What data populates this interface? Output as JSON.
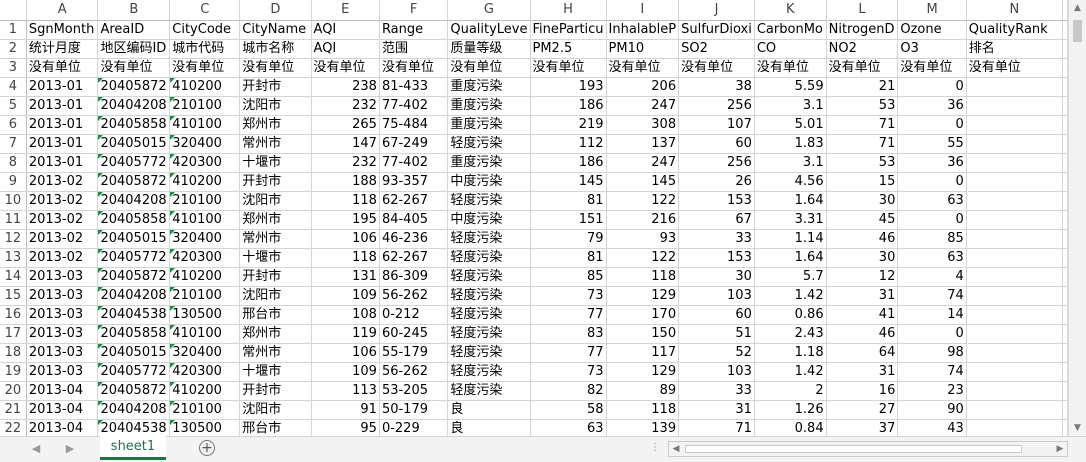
{
  "columns": [
    "A",
    "B",
    "C",
    "D",
    "E",
    "F",
    "G",
    "H",
    "I",
    "J",
    "K",
    "L",
    "M",
    "N"
  ],
  "rows": [
    {
      "n": "1",
      "cells": [
        "SgnMonth",
        "AreaID",
        "CityCode",
        "CityName",
        "AQI",
        "Range",
        "QualityLeve",
        "FineParticu",
        "InhalableP",
        "SulfurDioxi",
        "CarbonMo",
        "NitrogenD",
        "Ozone",
        "QualityRank"
      ]
    },
    {
      "n": "2",
      "cells": [
        "统计月度",
        "地区编码ID",
        "城市代码",
        "城市名称",
        "AQI",
        "范围",
        "质量等级",
        "PM2.5",
        "PM10",
        "SO2",
        "CO",
        "NO2",
        "O3",
        "排名"
      ]
    },
    {
      "n": "3",
      "cells": [
        "没有单位",
        "没有单位",
        "没有单位",
        "没有单位",
        "没有单位",
        "没有单位",
        "没有单位",
        "没有单位",
        "没有单位",
        "没有单位",
        "没有单位",
        "没有单位",
        "没有单位",
        "没有单位"
      ]
    },
    {
      "n": "4",
      "cells": [
        "2013-01",
        "20405872",
        "410200",
        "开封市",
        "238",
        "81-433",
        "重度污染",
        "193",
        "206",
        "38",
        "5.59",
        "21",
        "0",
        ""
      ]
    },
    {
      "n": "5",
      "cells": [
        "2013-01",
        "20404208",
        "210100",
        "沈阳市",
        "232",
        "77-402",
        "重度污染",
        "186",
        "247",
        "256",
        "3.1",
        "53",
        "36",
        ""
      ]
    },
    {
      "n": "6",
      "cells": [
        "2013-01",
        "20405858",
        "410100",
        "郑州市",
        "265",
        "75-484",
        "重度污染",
        "219",
        "308",
        "107",
        "5.01",
        "71",
        "0",
        ""
      ]
    },
    {
      "n": "7",
      "cells": [
        "2013-01",
        "20405015",
        "320400",
        "常州市",
        "147",
        "67-249",
        "轻度污染",
        "112",
        "137",
        "60",
        "1.83",
        "71",
        "55",
        ""
      ]
    },
    {
      "n": "8",
      "cells": [
        "2013-01",
        "20405772",
        "420300",
        "十堰市",
        "232",
        "77-402",
        "重度污染",
        "186",
        "247",
        "256",
        "3.1",
        "53",
        "36",
        ""
      ]
    },
    {
      "n": "9",
      "cells": [
        "2013-02",
        "20405872",
        "410200",
        "开封市",
        "188",
        "93-357",
        "中度污染",
        "145",
        "145",
        "26",
        "4.56",
        "15",
        "0",
        ""
      ]
    },
    {
      "n": "10",
      "cells": [
        "2013-02",
        "20404208",
        "210100",
        "沈阳市",
        "118",
        "62-267",
        "轻度污染",
        "81",
        "122",
        "153",
        "1.64",
        "30",
        "63",
        ""
      ]
    },
    {
      "n": "11",
      "cells": [
        "2013-02",
        "20405858",
        "410100",
        "郑州市",
        "195",
        "84-405",
        "中度污染",
        "151",
        "216",
        "67",
        "3.31",
        "45",
        "0",
        ""
      ]
    },
    {
      "n": "12",
      "cells": [
        "2013-02",
        "20405015",
        "320400",
        "常州市",
        "106",
        "46-236",
        "轻度污染",
        "79",
        "93",
        "33",
        "1.14",
        "46",
        "85",
        ""
      ]
    },
    {
      "n": "13",
      "cells": [
        "2013-02",
        "20405772",
        "420300",
        "十堰市",
        "118",
        "62-267",
        "轻度污染",
        "81",
        "122",
        "153",
        "1.64",
        "30",
        "63",
        ""
      ]
    },
    {
      "n": "14",
      "cells": [
        "2013-03",
        "20405872",
        "410200",
        "开封市",
        "131",
        "86-309",
        "轻度污染",
        "85",
        "118",
        "30",
        "5.7",
        "12",
        "4",
        ""
      ]
    },
    {
      "n": "15",
      "cells": [
        "2013-03",
        "20404208",
        "210100",
        "沈阳市",
        "109",
        "56-262",
        "轻度污染",
        "73",
        "129",
        "103",
        "1.42",
        "31",
        "74",
        ""
      ]
    },
    {
      "n": "16",
      "cells": [
        "2013-03",
        "20404538",
        "130500",
        "邢台市",
        "108",
        "0-212",
        "轻度污染",
        "77",
        "170",
        "60",
        "0.86",
        "41",
        "14",
        ""
      ]
    },
    {
      "n": "17",
      "cells": [
        "2013-03",
        "20405858",
        "410100",
        "郑州市",
        "119",
        "60-245",
        "轻度污染",
        "83",
        "150",
        "51",
        "2.43",
        "46",
        "0",
        ""
      ]
    },
    {
      "n": "18",
      "cells": [
        "2013-03",
        "20405015",
        "320400",
        "常州市",
        "106",
        "55-179",
        "轻度污染",
        "77",
        "117",
        "52",
        "1.18",
        "64",
        "98",
        ""
      ]
    },
    {
      "n": "19",
      "cells": [
        "2013-03",
        "20405772",
        "420300",
        "十堰市",
        "109",
        "56-262",
        "轻度污染",
        "73",
        "129",
        "103",
        "1.42",
        "31",
        "74",
        ""
      ]
    },
    {
      "n": "20",
      "cells": [
        "2013-04",
        "20405872",
        "410200",
        "开封市",
        "113",
        "53-205",
        "轻度污染",
        "82",
        "89",
        "33",
        "2",
        "16",
        "23",
        ""
      ]
    },
    {
      "n": "21",
      "cells": [
        "2013-04",
        "20404208",
        "210100",
        "沈阳市",
        "91",
        "50-179",
        "良",
        "58",
        "118",
        "31",
        "1.26",
        "27",
        "90",
        ""
      ]
    },
    {
      "n": "22",
      "cells": [
        "2013-04",
        "20404538",
        "130500",
        "邢台市",
        "95",
        "0-229",
        "良",
        "63",
        "139",
        "71",
        "0.84",
        "37",
        "43",
        ""
      ]
    }
  ],
  "sheet_tab": "sheet1",
  "icons": {
    "add_sheet": "+",
    "scroll_up": "▲",
    "scroll_down": "▼",
    "scroll_left": "◀",
    "scroll_right": "▶",
    "nav_prev": "◀",
    "nav_next": "▶",
    "more": "⋮"
  },
  "colors": {
    "accent": "#217346",
    "indicator": "#1f8a4c",
    "gridline": "#d4d4d4"
  }
}
